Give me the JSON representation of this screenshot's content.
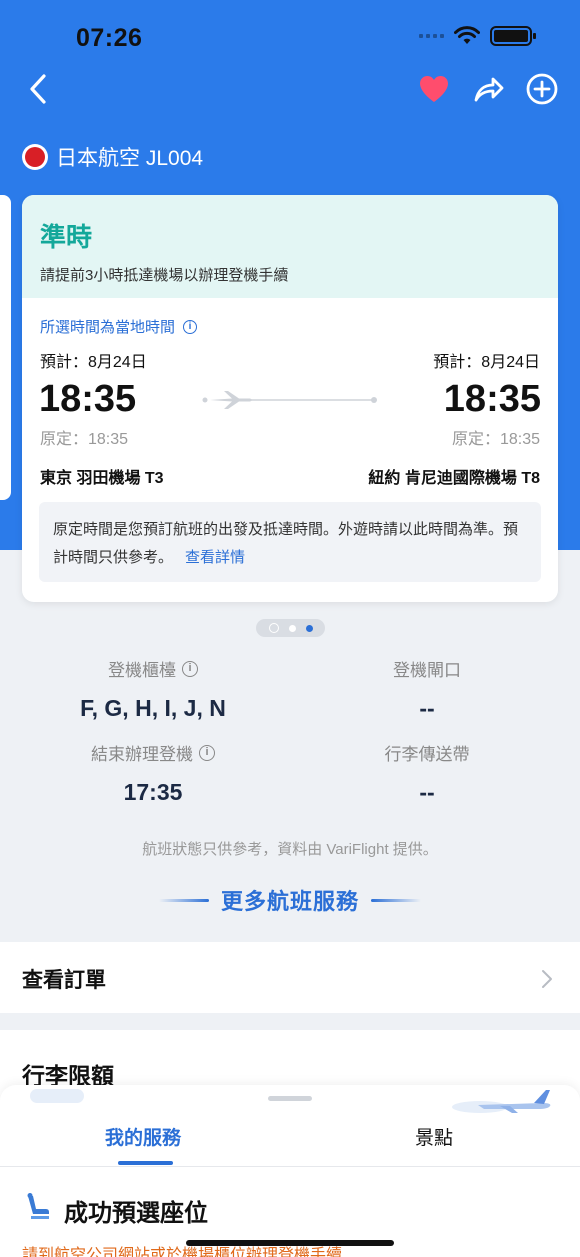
{
  "status_bar": {
    "time": "07:26"
  },
  "airline": {
    "name": "日本航空 JL004"
  },
  "card": {
    "status": "準時",
    "notice": "請提前3小時抵達機場以辦理登機手續",
    "local_time_note": "所選時間為當地時間",
    "departure": {
      "est_label": "預計：8月24日",
      "time": "18:35",
      "scheduled": "原定：18:35",
      "airport": "東京 羽田機場 T3"
    },
    "arrival": {
      "est_label": "預計：8月24日",
      "time": "18:35",
      "scheduled": "原定：18:35",
      "airport": "紐約 肯尼迪國際機場 T8"
    },
    "explain": "原定時間是您預訂航班的出發及抵達時間。外遊時請以此時間為準。預計時間只供參考。",
    "details_link": "查看詳情"
  },
  "info": {
    "checkin_counter_label": "登機櫃檯",
    "checkin_counter_value": "F, G, H, I, J, N",
    "gate_label": "登機閘口",
    "gate_value": "--",
    "checkin_close_label": "結束辦理登機",
    "checkin_close_value": "17:35",
    "baggage_label": "行李傳送帶",
    "baggage_value": "--"
  },
  "disclaimer": "航班狀態只供參考，資料由 VariFlight 提供。",
  "more_services": "更多航班服務",
  "orders_label": "查看訂單",
  "baggage_allowance_label": "行李限額",
  "sheet": {
    "tab_mine": "我的服務",
    "tab_spots": "景點",
    "seat_title": "成功預選座位",
    "seat_sub": "請到航空公司網站或於機場櫃位辦理登機手續"
  },
  "colors": {
    "primary_blue": "#2b7bea",
    "accent_blue": "#2b6fd6",
    "on_time_teal": "#14a89a",
    "heart_pink": "#ff4d6d",
    "warning_orange": "#e06a1b"
  }
}
